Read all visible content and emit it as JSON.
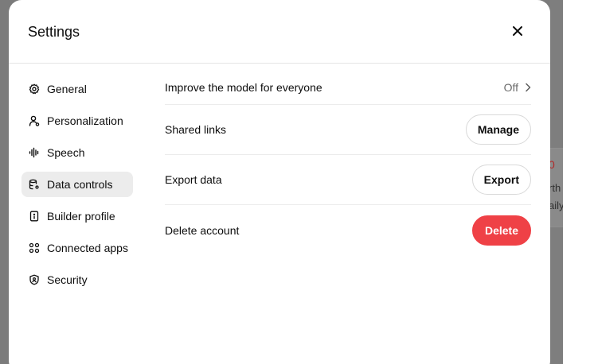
{
  "background": {
    "fragments": [
      "0",
      "rth",
      "aily"
    ]
  },
  "modal": {
    "title": "Settings",
    "close_icon": "close-icon"
  },
  "sidebar": {
    "items": [
      {
        "label": "General",
        "icon": "gear-icon",
        "active": false
      },
      {
        "label": "Personalization",
        "icon": "person-icon",
        "active": false
      },
      {
        "label": "Speech",
        "icon": "waveform-icon",
        "active": false
      },
      {
        "label": "Data controls",
        "icon": "database-gear-icon",
        "active": true
      },
      {
        "label": "Builder profile",
        "icon": "id-card-icon",
        "active": false
      },
      {
        "label": "Connected apps",
        "icon": "apps-grid-icon",
        "active": false
      },
      {
        "label": "Security",
        "icon": "shield-icon",
        "active": false
      }
    ]
  },
  "data_controls": {
    "improve_model": {
      "label": "Improve the model for everyone",
      "value": "Off"
    },
    "shared_links": {
      "label": "Shared links",
      "button": "Manage"
    },
    "export_data": {
      "label": "Export data",
      "button": "Export"
    },
    "delete_account": {
      "label": "Delete account",
      "button": "Delete"
    }
  },
  "colors": {
    "danger": "#ef4146",
    "active_bg": "#ececec",
    "overlay": "#7b7b7b"
  }
}
